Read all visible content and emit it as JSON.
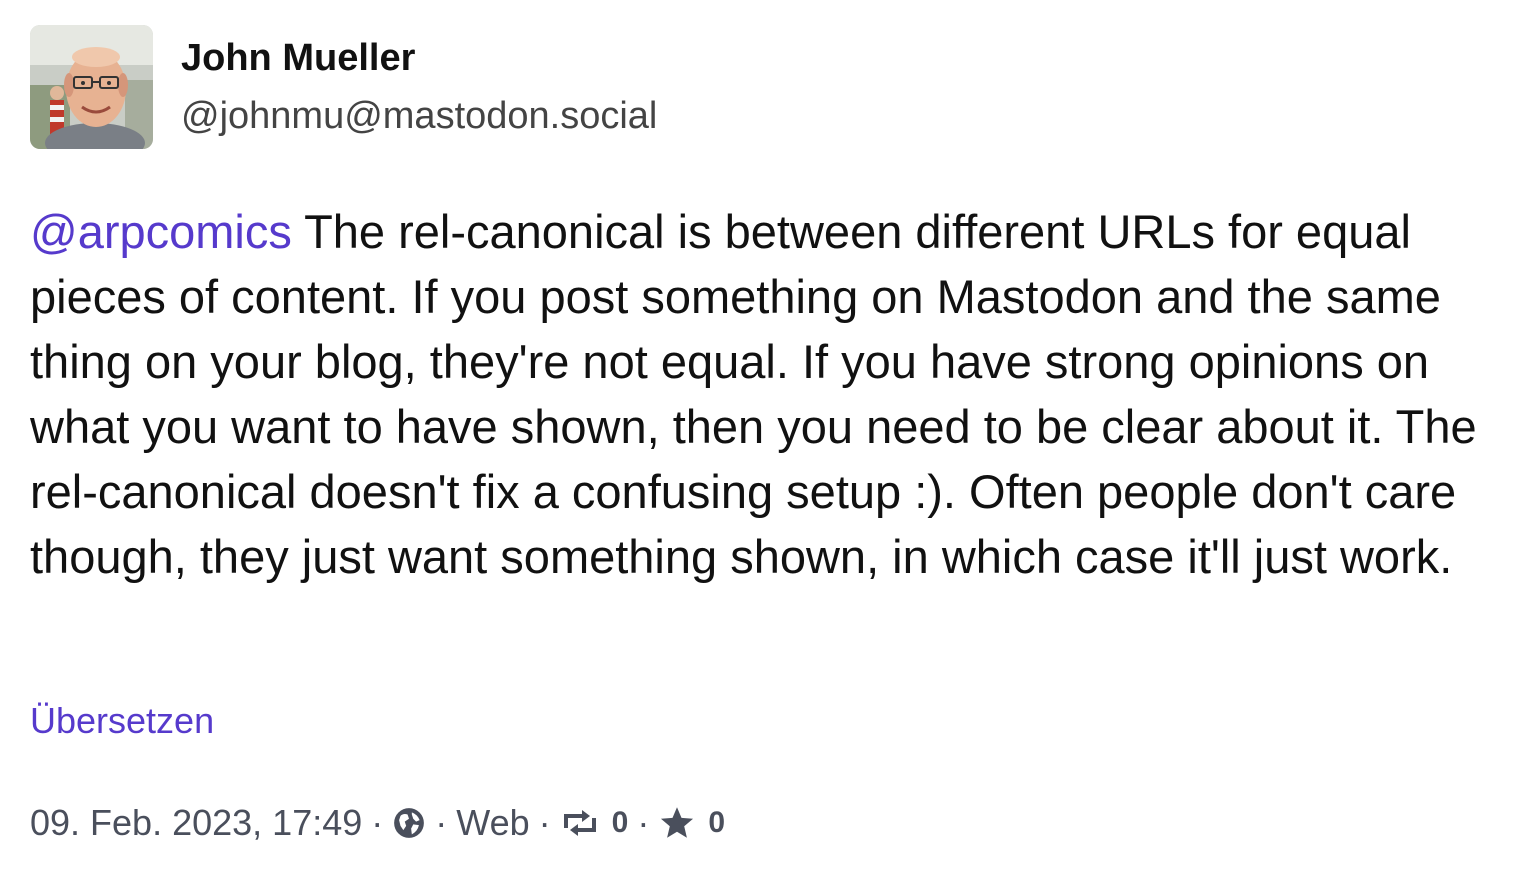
{
  "author": {
    "display_name": "John Mueller",
    "handle": "@johnmu@mastodon.social"
  },
  "status": {
    "mention": "@arpcomics",
    "text": " The rel-canonical is between different URLs for equal pieces of content. If you post something on Mastodon and the same thing on your blog, they're not equal. If you have strong opinions on what you want to have shown, then you need to be clear about it. The rel-canonical doesn't fix a confusing setup :). Often people don't care though, they just want something shown, in which case it'll just work."
  },
  "translate_label": "Übersetzen",
  "meta": {
    "timestamp": "09. Feb. 2023, 17:49",
    "separator": "·",
    "visibility_icon": "globe-icon",
    "application": "Web",
    "reblog_icon": "retweet-icon",
    "reblog_count": "0",
    "favourite_icon": "star-icon",
    "favourite_count": "0"
  },
  "colors": {
    "link": "#563acc",
    "meta": "#4a4f5c",
    "text": "#111111"
  }
}
